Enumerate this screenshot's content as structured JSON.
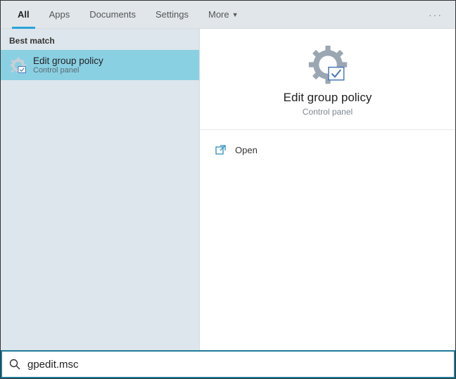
{
  "tabs": {
    "items": [
      "All",
      "Apps",
      "Documents",
      "Settings",
      "More"
    ],
    "active_index": 0
  },
  "left": {
    "section_heading": "Best match",
    "results": [
      {
        "title": "Edit group policy",
        "sub": "Control panel"
      }
    ]
  },
  "right": {
    "title": "Edit group policy",
    "sub": "Control panel",
    "actions": [
      {
        "label": "Open"
      }
    ]
  },
  "search": {
    "value": "gpedit.msc",
    "placeholder": ""
  }
}
